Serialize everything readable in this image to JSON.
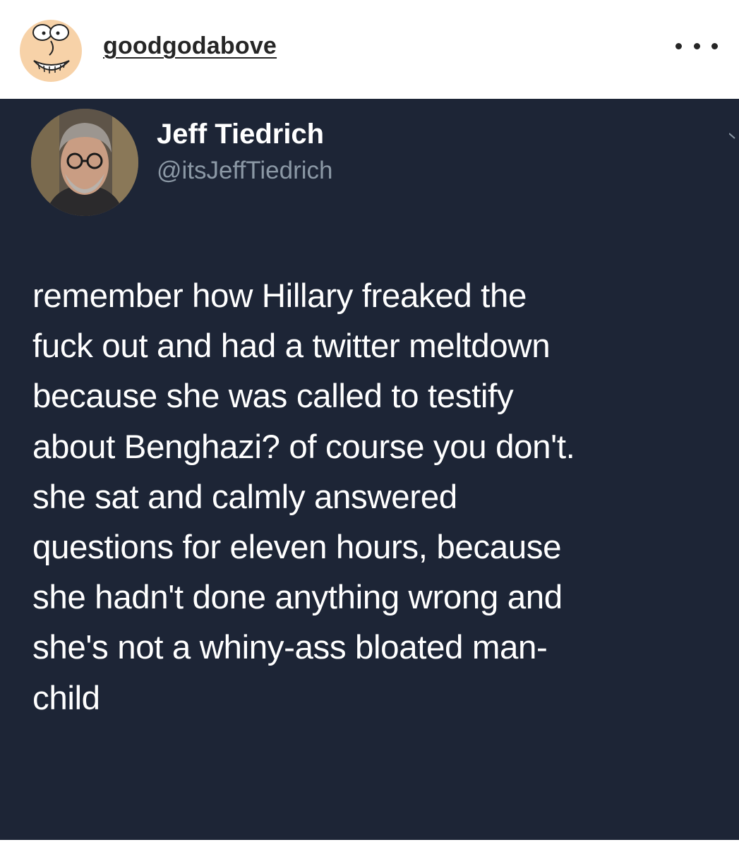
{
  "post": {
    "username": "goodgodabove",
    "more_icon": "more-horizontal-icon"
  },
  "tweet": {
    "display_name": "Jeff Tiedrich",
    "handle": "@itsJeffTiedrich",
    "text": "remember how Hillary freaked the\nfuck out and had a twitter meltdown\nbecause she was called to testify\nabout Benghazi? of course you don't.\nshe sat and calmly answered\nquestions for eleven hours, because\nshe hadn't done anything wrong and\nshe's not a whiny-ass bloated man-\nchild",
    "caret_icon": "chevron-down-icon"
  },
  "colors": {
    "tweet_background": "#1d2536",
    "tweet_text": "#ffffff",
    "handle_text": "#8b98a5",
    "username_text": "#262626"
  }
}
